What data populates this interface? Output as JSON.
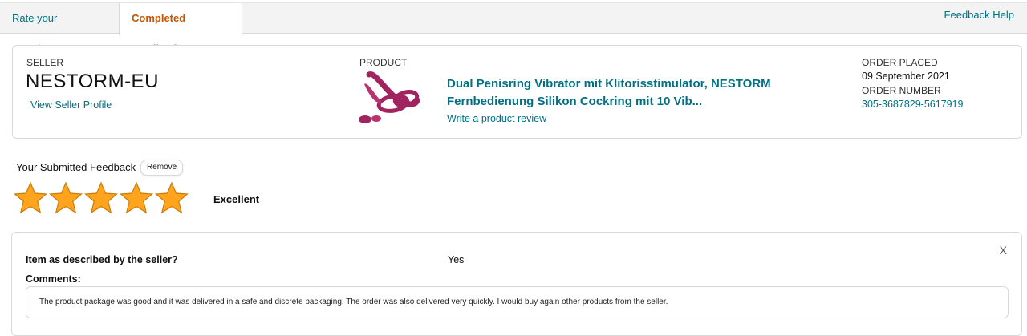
{
  "tabs": {
    "rate_label": "Rate your experience",
    "completed_label": "Completed Feedback",
    "help_label": "Feedback Help"
  },
  "seller": {
    "label": "SELLER",
    "name": "NESTORM-EU",
    "profile_link": "View Seller Profile"
  },
  "product": {
    "label": "PRODUCT",
    "title": "Dual Penisring Vibrator mit Klitorisstimulator, NESTORM Fernbedienung Silikon Cockring mit 10 Vib...",
    "review_link": "Write a product review",
    "thumb_color": "#a0245f"
  },
  "order": {
    "placed_label": "ORDER PLACED",
    "placed_date": "09 September 2021",
    "number_label": "ORDER NUMBER",
    "number": "305-3687829-5617919"
  },
  "feedback": {
    "submitted_label": "Your Submitted Feedback",
    "remove_label": "Remove",
    "stars": 5,
    "star_color": "#ffa41c",
    "rating_text": "Excellent"
  },
  "details": {
    "question": "Item as described by the seller?",
    "answer": "Yes",
    "close_label": "X",
    "comments_label": "Comments:",
    "comment": "The product package was good and it was delivered in a safe and discrete packaging. The order was also delivered very quickly. I would buy again other products from the seller."
  }
}
